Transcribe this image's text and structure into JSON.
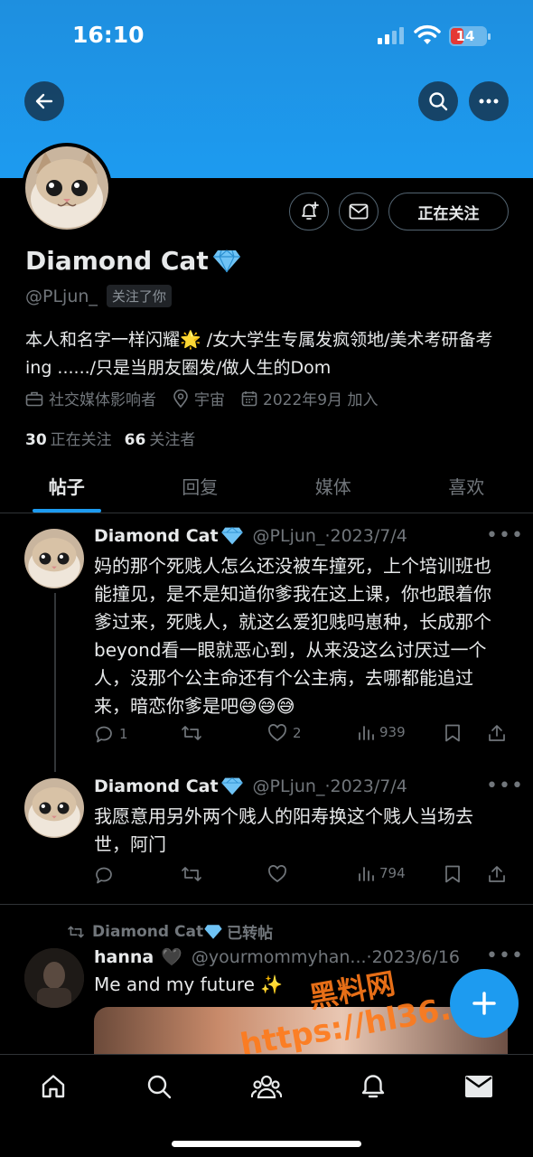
{
  "status_bar": {
    "time": "16:10",
    "battery": "14"
  },
  "profile": {
    "name": "Diamond Cat",
    "handle": "@PLjun_",
    "follows_you": "关注了你",
    "bio": "本人和名字一样闪耀🌟 /女大学生专属发疯领地/美术考研备考ing ....../只是当朋友圈发/做人生的Dom",
    "category": "社交媒体影响者",
    "location": "宇宙",
    "joined": "2022年9月 加入",
    "following_count": "30",
    "following_label": "正在关注",
    "followers_count": "66",
    "followers_label": "关注者",
    "following_button": "正在关注"
  },
  "tabs": [
    {
      "label": "帖子"
    },
    {
      "label": "回复"
    },
    {
      "label": "媒体"
    },
    {
      "label": "喜欢"
    }
  ],
  "posts": [
    {
      "name": "Diamond Cat",
      "handle": "@PLjun_·2023/7/4",
      "text": "妈的那个死贱人怎么还没被车撞死，上个培训班也能撞见，是不是知道你爹我在这上课，你也跟着你爹过来，死贱人，就这么爱犯贱吗崽种，长成那个beyond看一眼就恶心到，从来没这么讨厌过一个人，没那个公主命还有个公主病，去哪都能追过来，暗恋你爹是吧😅😅😅",
      "replies": "1",
      "likes": "2",
      "views": "939"
    },
    {
      "name": "Diamond Cat",
      "handle": "@PLjun_·2023/7/4",
      "text": "我愿意用另外两个贱人的阳寿换这个贱人当场去世，阿门",
      "views": "794"
    },
    {
      "retweeted_by": "Diamond Cat",
      "retweeted_label": "已转帖",
      "name": "hanna",
      "handle": "@yourmommyhan...·2023/6/16",
      "text": "Me and my future ✨"
    }
  ],
  "watermark": {
    "line1": "黑料网",
    "line2": "https://hl36.co"
  },
  "colors": {
    "accent": "#1d9bf0",
    "banner": "#1d9bf0",
    "background": "#000000",
    "muted": "#71767b"
  },
  "icons": [
    "back-arrow-icon",
    "search-icon",
    "more-icon",
    "notification-bell-plus-icon",
    "mail-icon",
    "briefcase-icon",
    "location-pin-icon",
    "calendar-icon",
    "reply-icon",
    "retweet-icon",
    "like-icon",
    "views-icon",
    "bookmark-icon",
    "share-icon",
    "home-icon",
    "explore-search-icon",
    "communities-icon",
    "notifications-icon",
    "messages-icon",
    "compose-plus-icon"
  ]
}
